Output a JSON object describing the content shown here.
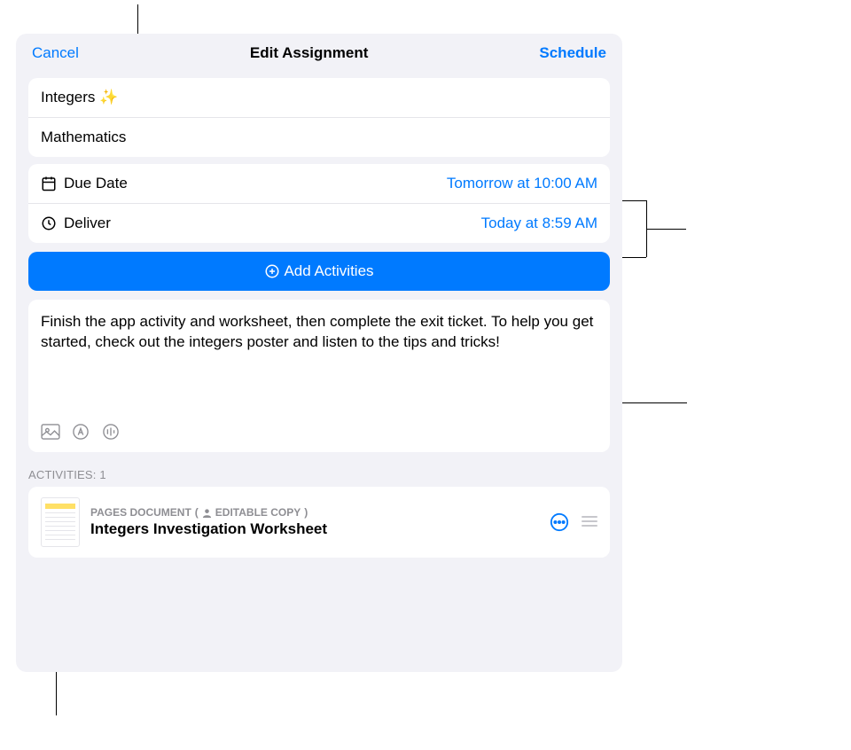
{
  "header": {
    "cancel_label": "Cancel",
    "title": "Edit Assignment",
    "schedule_label": "Schedule"
  },
  "assignment": {
    "title": "Integers ✨",
    "subject": "Mathematics"
  },
  "schedule": {
    "due_date_label": "Due Date",
    "due_date_value": "Tomorrow at 10:00 AM",
    "deliver_label": "Deliver",
    "deliver_value": "Today at 8:59 AM"
  },
  "buttons": {
    "add_activities": "Add Activities"
  },
  "instructions": {
    "text": "Finish the app activity and worksheet, then complete the exit ticket. To help you get started, check out the integers poster and listen to the tips and tricks!"
  },
  "activities": {
    "section_label": "ACTIVITIES: 1",
    "items": [
      {
        "type": "PAGES DOCUMENT",
        "copy_type": "EDITABLE COPY",
        "title": "Integers Investigation Worksheet"
      }
    ]
  }
}
